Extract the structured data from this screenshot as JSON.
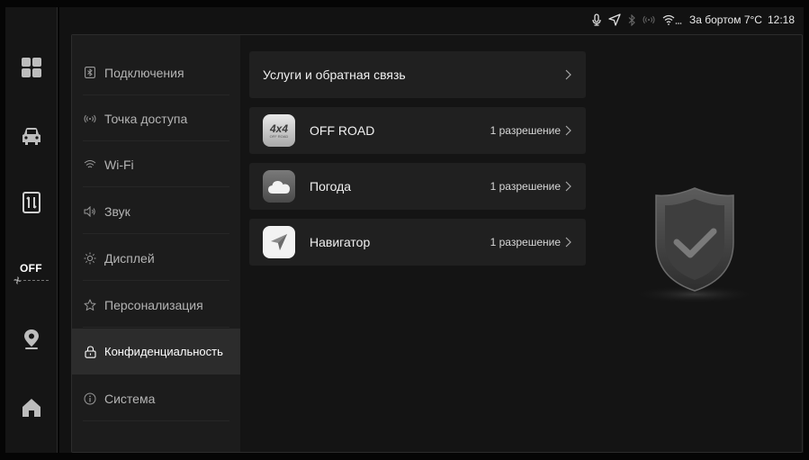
{
  "status_bar": {
    "icons": [
      "mic-icon",
      "location-arrow-icon",
      "bluetooth-icon",
      "hotspot-icon",
      "wifi-icon"
    ],
    "outside_temp_label": "За бортом 7°C",
    "time": "12:18"
  },
  "dock": {
    "items": [
      {
        "name": "apps-grid-icon"
      },
      {
        "name": "car-icon"
      },
      {
        "name": "phone-mirror-icon"
      },
      {
        "name": "climate-off-button",
        "label": "OFF"
      },
      {
        "name": "map-pin-icon"
      },
      {
        "name": "home-icon"
      }
    ]
  },
  "nav": {
    "items": [
      {
        "label": "Подключения",
        "icon": "bluetooth-box-icon"
      },
      {
        "label": "Точка доступа",
        "icon": "hotspot-icon"
      },
      {
        "label": "Wi-Fi",
        "icon": "wifi-icon"
      },
      {
        "label": "Звук",
        "icon": "speaker-icon"
      },
      {
        "label": "Дисплей",
        "icon": "brightness-icon"
      },
      {
        "label": "Персонализация",
        "icon": "star-icon"
      },
      {
        "label": "Конфиденциальность",
        "icon": "lock-icon",
        "active": true
      },
      {
        "label": "Система",
        "icon": "info-icon"
      }
    ]
  },
  "content": {
    "feedback_label": "Услуги и обратная связь",
    "apps": [
      {
        "name": "OFF ROAD",
        "permissions": "1 разрешение",
        "icon": "offroad-app-icon",
        "icon_text": "4x4",
        "icon_subtext": "OFF ROAD"
      },
      {
        "name": "Погода",
        "permissions": "1 разрешение",
        "icon": "weather-app-icon"
      },
      {
        "name": "Навигатор",
        "permissions": "1 разрешение",
        "icon": "navigator-app-icon"
      }
    ]
  },
  "colors": {
    "background": "#050505",
    "panel": "#141414",
    "nav_bg": "#1c1c1c",
    "nav_active": "#2c2c2c",
    "card": "#202020"
  }
}
